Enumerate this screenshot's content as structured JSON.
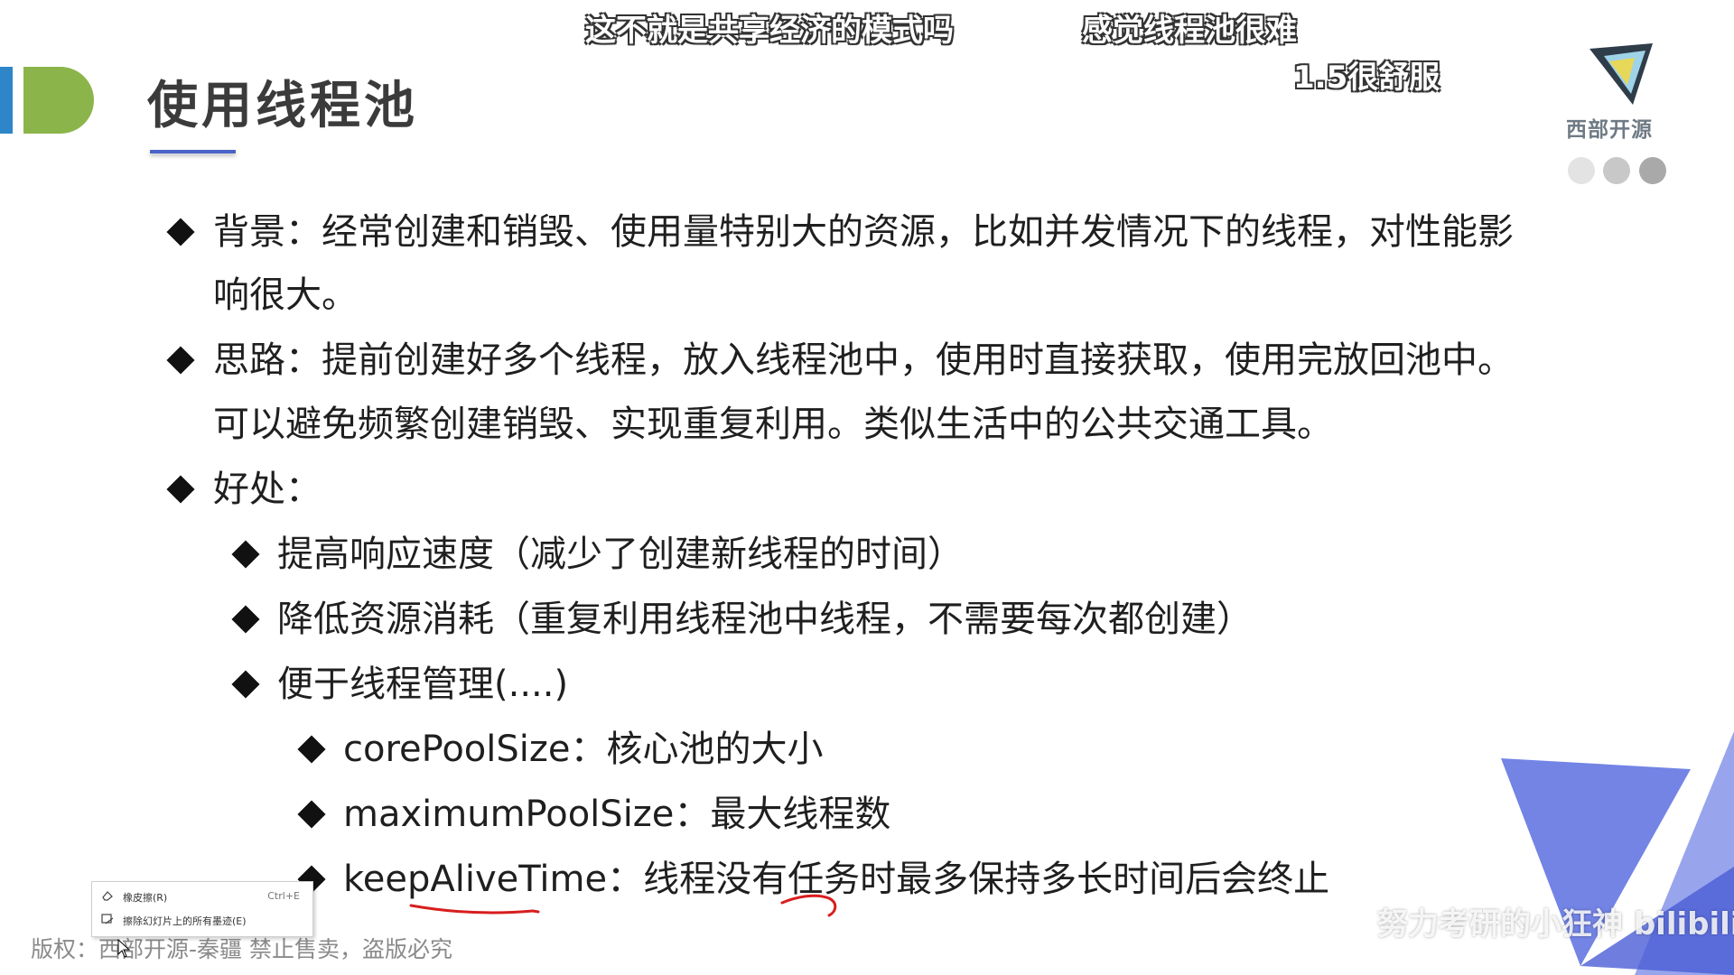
{
  "slide": {
    "title": "使用线程池",
    "logo_text": "西部开源",
    "bullets": [
      {
        "text": "背景：经常创建和销毁、使用量特别大的资源，比如并发情况下的线程，对性能影"
      },
      {
        "text": "响很大。"
      },
      {
        "text": "思路：提前创建好多个线程，放入线程池中，使用时直接获取，使用完放回池中。"
      },
      {
        "text": "可以避免频繁创建销毁、实现重复利用。类似生活中的公共交通工具。"
      },
      {
        "text": "好处："
      }
    ],
    "sub_bullets": [
      {
        "text": "提高响应速度（减少了创建新线程的时间）"
      },
      {
        "text": "降低资源消耗（重复利用线程池中线程，不需要每次都创建）"
      },
      {
        "text": "便于线程管理(....)"
      }
    ],
    "sub_sub_bullets": [
      {
        "text": "corePoolSize：核心池的大小"
      },
      {
        "text": "maximumPoolSize：最大线程数"
      },
      {
        "text": "keepAliveTime：线程没有任务时最多保持多长时间后会终止"
      }
    ],
    "copyright": "版权：西部开源-秦疆     禁止售卖，盗版必究"
  },
  "danmaku": [
    {
      "text": "这不就是共享经济的模式吗"
    },
    {
      "text": "感觉线程池很难"
    },
    {
      "text": "1.5很舒服"
    }
  ],
  "watermark": "努力考研的小狂神 bilibili",
  "context_menu": {
    "items": [
      {
        "label": "橡皮擦(R)",
        "shortcut": "Ctrl+E",
        "icon": "eraser-icon"
      },
      {
        "label": "擦除幻灯片上的所有墨迹(E)",
        "shortcut": "",
        "icon": "erase-all-icon"
      }
    ]
  },
  "colors": {
    "accent_blue": "#2e86c8",
    "accent_green": "#8bb54a",
    "underline": "#4a63c8",
    "deco_triangle": "#5b6fe0",
    "pen_mark": "#d81e1e"
  }
}
